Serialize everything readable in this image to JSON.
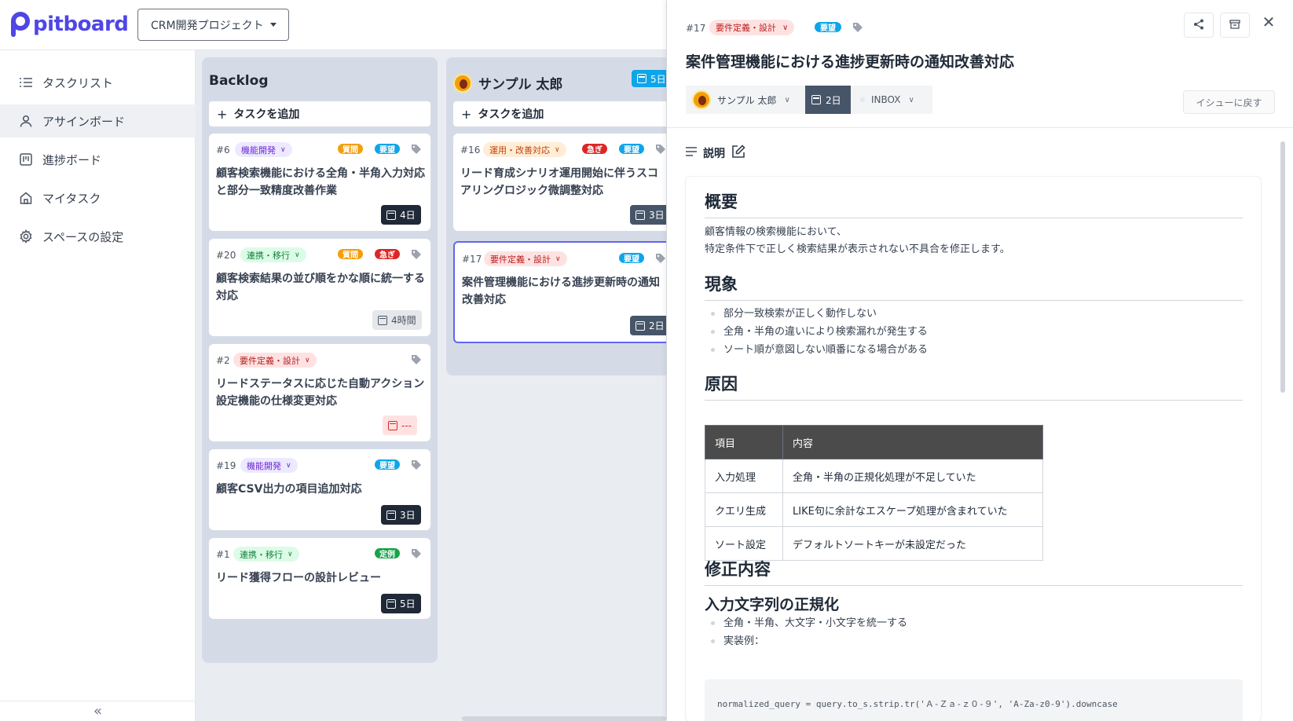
{
  "brand": {
    "name": "pitboard",
    "accent": "#4f46e5"
  },
  "project_select": {
    "value": "CRM開発プロジェクト"
  },
  "sidebar": {
    "items": [
      {
        "label": "タスクリスト",
        "icon": "list-icon"
      },
      {
        "label": "アサインボード",
        "icon": "user-icon",
        "active": true
      },
      {
        "label": "進捗ボード",
        "icon": "kanban-icon"
      },
      {
        "label": "マイタスク",
        "icon": "home-icon"
      },
      {
        "label": "スペースの設定",
        "icon": "gear-icon"
      }
    ],
    "collapse": "«"
  },
  "board": {
    "add_task_label": "タスクを追加",
    "columns": [
      {
        "title": "Backlog",
        "cards": [
          {
            "num": "#6",
            "category": "機能開発",
            "pills": [
              "質問",
              "要望"
            ],
            "title_l1": "顧客検索機能における全角・半角入力対応",
            "title_l2": "と部分一致精度改善作業",
            "due": "4日"
          },
          {
            "num": "#20",
            "category": "連携・移行",
            "pills": [
              "質問",
              "急ぎ"
            ],
            "title_l1": "顧客検索結果の並び順をかな順に統一する",
            "title_l2": "対応",
            "due": "4時間"
          },
          {
            "num": "#2",
            "category": "要件定義・設計",
            "pills": [],
            "title_l1": "リードステータスに応じた自動アクション",
            "title_l2": "設定機能の仕様変更対応",
            "due": "---"
          },
          {
            "num": "#19",
            "category": "機能開発",
            "pills": [
              "要望"
            ],
            "title_l1": "顧客CSV出力の項目追加対応",
            "title_l2": "",
            "due": "3日"
          },
          {
            "num": "#1",
            "category": "連携・移行",
            "pills": [
              "定例"
            ],
            "title_l1": "リード獲得フローの設計レビュー",
            "title_l2": "",
            "due": "5日"
          }
        ]
      },
      {
        "title": "サンプル 太郎",
        "badge": "5日",
        "cards": [
          {
            "num": "#16",
            "category": "運用・改善対応",
            "pills": [
              "急ぎ",
              "要望"
            ],
            "title_l1": "リード育成シナリオ運用開始に伴うスコ",
            "title_l2": "アリングロジック微調整対応",
            "due": "3日"
          },
          {
            "num": "#17",
            "category": "要件定義・設計",
            "pills": [
              "要望"
            ],
            "title_l1": "案件管理機能における進捗更新時の通知",
            "title_l2": "改善対応",
            "due": "2日"
          }
        ]
      }
    ]
  },
  "detail": {
    "num": "#17",
    "category": "要件定義・設計",
    "pill": "要望",
    "title": "案件管理機能における進捗更新時の通知改善対応",
    "assignee": "サンプル 太郎",
    "days": "2日",
    "status": "INBOX",
    "back_button": "イシューに戻す",
    "desc_label": "説明",
    "doc": {
      "h_overview": "概要",
      "overview_l1": "顧客情報の検索機能において、",
      "overview_l2": "特定条件下で正しく検索結果が表示されない不具合を修正します。",
      "h_symptom": "現象",
      "symptoms": [
        "部分一致検索が正しく動作しない",
        "全角・半角の違いにより検索漏れが発生する",
        "ソート順が意図しない順番になる場合がある"
      ],
      "h_cause": "原因",
      "table_headers": [
        "項目",
        "内容"
      ],
      "table_rows": [
        [
          "入力処理",
          "全角・半角の正規化処理が不足していた"
        ],
        [
          "クエリ生成",
          "LIKE句に余計なエスケープ処理が含まれていた"
        ],
        [
          "ソート設定",
          "デフォルトソートキーが未設定だった"
        ]
      ],
      "h_fix": "修正内容",
      "h_normalize": "入力文字列の正規化",
      "fix_items": [
        "全角・半角、大文字・小文字を統一する",
        "実装例："
      ],
      "code": "normalized_query = query.to_s.strip.tr('Ａ-Ｚａ-ｚ０-９', 'A-Za-z0-9').downcase"
    }
  }
}
